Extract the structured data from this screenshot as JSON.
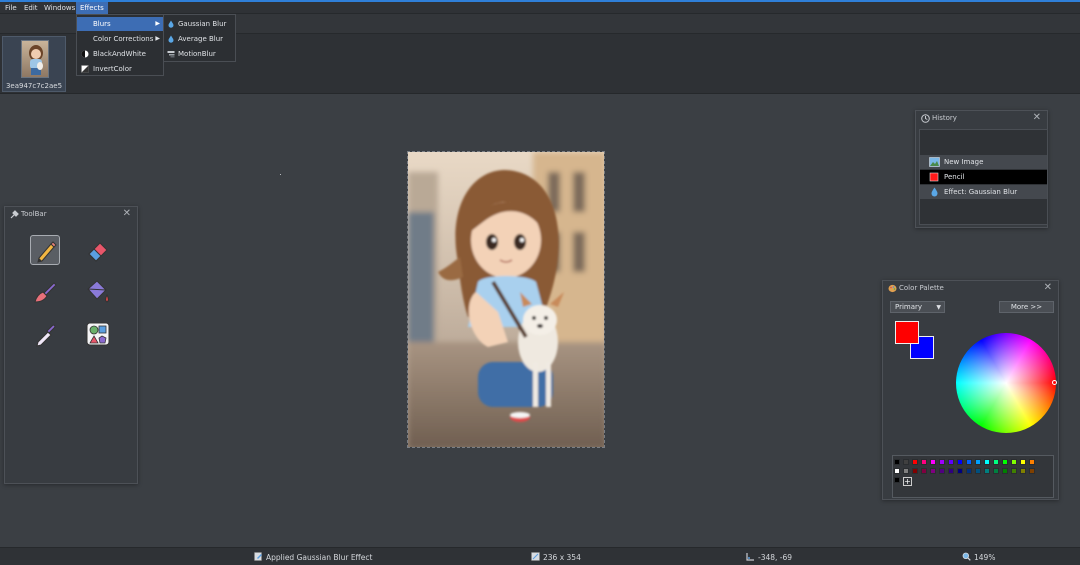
{
  "menubar": {
    "items": [
      "File",
      "Edit",
      "Windows",
      "Effects"
    ],
    "active": "Effects"
  },
  "effects_menu": {
    "items": [
      "Blurs",
      "Color Corrections",
      "BlackAndWhite",
      "InvertColor"
    ]
  },
  "blurs_submenu": {
    "items": [
      "Gaussian Blur",
      "Average Blur",
      "MotionBlur"
    ]
  },
  "thumbnail": {
    "label": "3ea947c7c2ae5"
  },
  "toolbar_panel": {
    "title": "ToolBar",
    "close": "✕",
    "tools": [
      "pencil-icon",
      "eraser-icon",
      "brush-icon",
      "paint-bucket-icon",
      "eyedropper-icon",
      "shapes-icon"
    ],
    "selected": "pencil-icon"
  },
  "history_panel": {
    "title": "History",
    "close": "✕",
    "items": [
      "New Image",
      "Pencil",
      "Effect: Gaussian Blur"
    ],
    "selected_index": 1
  },
  "color_panel": {
    "title": "Color Palette",
    "close": "✕",
    "mode": "Primary",
    "more_label": "More >>",
    "primary_color": "#ff0000",
    "secondary_color": "#0000ff"
  },
  "status": {
    "message": "Applied Gaussian Blur Effect",
    "dimensions": "236 x 354",
    "cursor": "-348, -69",
    "zoom": "149%"
  },
  "colors": {
    "accent": "#3d6db4",
    "background": "#3b3f44",
    "panel": "#383c41"
  }
}
